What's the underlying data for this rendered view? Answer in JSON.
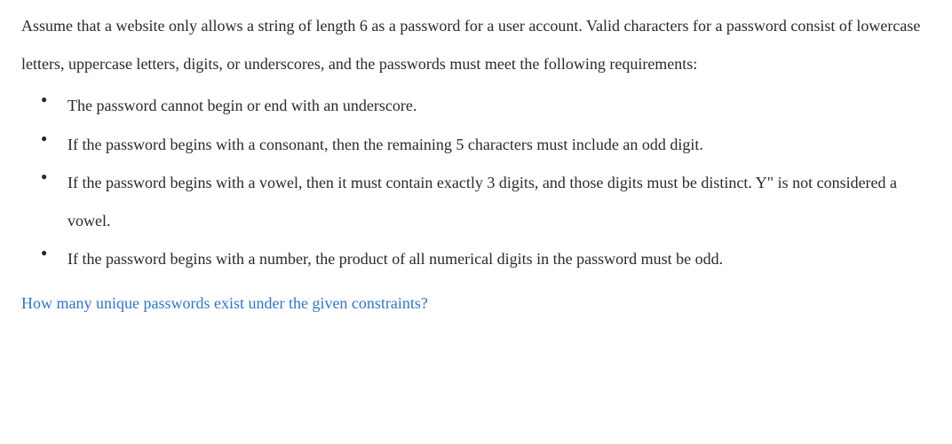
{
  "intro": "Assume that a website only allows a string of length 6 as a password for a user account. Valid characters for a password consist of lowercase letters, uppercase letters, digits, or underscores, and the passwords must meet the following requirements:",
  "bullets": [
    "The password cannot begin or end with an underscore.",
    "If the password begins with a consonant, then the remaining 5 characters must include an odd digit.",
    "If the password begins with a vowel, then it must contain exactly 3 digits, and those digits must be distinct. Y\" is not considered a vowel.",
    "If the password begins with a number, the product of all numerical digits in the password must be odd."
  ],
  "question": "How many unique passwords exist under the given constraints?"
}
